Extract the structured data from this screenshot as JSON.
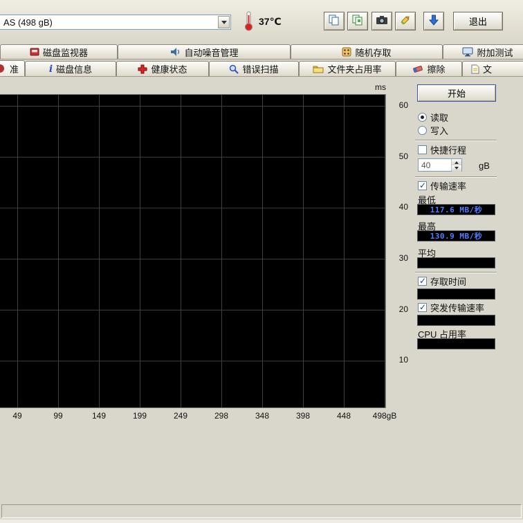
{
  "colors": {
    "plot_background": "#000000",
    "grid_line": "#414141",
    "lcd_text": "#4f7dff",
    "accent_blue": "#2e6fd0"
  },
  "toolbar": {
    "drive_select_value": "AS (498 gB)",
    "temperature": "37℃",
    "exit_label": "退出",
    "button_icons": [
      "copy-icon",
      "copy-pages-icon",
      "camera-icon",
      "save-icon",
      "down-arrow-icon"
    ]
  },
  "tabs_row1": {
    "items": [
      {
        "label": "磁盘监视器",
        "icon": "disk-monitor-icon"
      },
      {
        "label": "自动噪音管理",
        "icon": "speaker-icon"
      },
      {
        "label": "随机存取",
        "icon": "dice-icon"
      },
      {
        "label": "附加测试",
        "icon": "monitor-icon"
      }
    ]
  },
  "tabs_row2": {
    "items": [
      {
        "label": "准",
        "icon": "benchmark-icon"
      },
      {
        "label": "磁盘信息",
        "icon": "info-icon"
      },
      {
        "label": "健康状态",
        "icon": "health-cross-icon"
      },
      {
        "label": "错误扫描",
        "icon": "magnifier-icon"
      },
      {
        "label": "文件夹占用率",
        "icon": "folder-icon"
      },
      {
        "label": "擦除",
        "icon": "eraser-icon"
      },
      {
        "label": "文",
        "icon": "document-icon"
      }
    ]
  },
  "panel": {
    "start_button": "开始",
    "read_label": "读取",
    "write_label": "写入",
    "selected_mode": "读取",
    "short_stroke_label": "快捷行程",
    "short_stroke_checked": false,
    "short_stroke_value": "40",
    "short_stroke_unit": "gB",
    "transfer_rate_label": "传输速率",
    "transfer_rate_checked": true,
    "min_label": "最低",
    "min_value": "117.6 MB/秒",
    "max_label": "最高",
    "max_value": "130.9 MB/秒",
    "avg_label": "平均",
    "avg_value": "",
    "access_time_label": "存取时间",
    "access_time_checked": true,
    "access_time_value": "",
    "burst_rate_label": "突发传输速率",
    "burst_rate_checked": true,
    "burst_rate_value": "",
    "cpu_label": "CPU 占用率",
    "cpu_value": ""
  },
  "chart_data": {
    "type": "line",
    "title": "",
    "x_ticks": [
      "49",
      "99",
      "149",
      "199",
      "249",
      "298",
      "348",
      "398",
      "448",
      "498gB"
    ],
    "y_right_unit": "ms",
    "y_right_ticks": [
      "60",
      "50",
      "40",
      "30",
      "20",
      "10"
    ],
    "series": [],
    "grid": true,
    "plot_background": "#000000"
  }
}
